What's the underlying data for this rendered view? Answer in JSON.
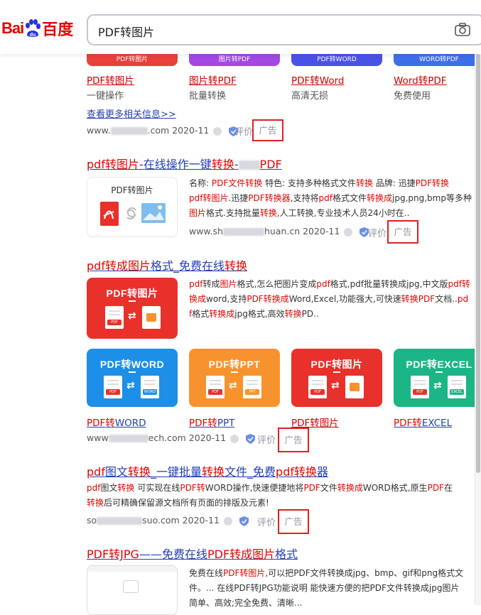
{
  "search": {
    "query": "PDF转图片"
  },
  "logo": {
    "bai": "Bai",
    "du": "du",
    "baidu_cn": "百度"
  },
  "ad1": {
    "bands": [
      "PDF转图片",
      "图片转PDF",
      "PDF转WORD",
      "WORD转PDF"
    ],
    "links": [
      "PDF转图片",
      "图片转PDF",
      "PDF转Word",
      "Word转PDF"
    ],
    "subs": [
      "一键操作",
      "批量转换",
      "高清无损",
      "免费使用"
    ],
    "more": "查看更多相关信息>>",
    "url_prefix": "www.",
    "url_suffix": ".com 2020-11",
    "review": "评价",
    "ad": "广告"
  },
  "result2": {
    "title_parts": [
      "pdf",
      "转图片",
      "-在线操作一键",
      "转换",
      "-",
      "PDF"
    ],
    "thumb_label": "PDF转图片",
    "desc_lines": [
      [
        "名称: ",
        "PDF文件转换",
        "    特色: 支持多种格式文件",
        "转换",
        "    品牌: 迅捷",
        "PDF转换"
      ],
      [
        "pdf转图片",
        ".迅捷",
        "PDF转换器",
        ",支持将",
        "pdf",
        "格式文件",
        "转换成",
        "jpg,png,bmp等多种"
      ],
      [
        "图片",
        "格式.支持批量",
        "转换",
        ",人工转换,专业技术人员24小时在.."
      ]
    ],
    "url_prefix": "www.sh",
    "url_suffix": "huan.cn 2020-11",
    "review": "评价",
    "ad": "广告"
  },
  "result3": {
    "title_parts": [
      "pdf",
      "转成",
      "图片",
      "格式_免费在线",
      "转换"
    ],
    "promo_main": "PDF转图片",
    "desc_lines": [
      [
        "pdf",
        "转成",
        "图片",
        "格式,怎么把图片变成",
        "pdf",
        "格式,pdf批量转换成jpg,中文版",
        "pdf转"
      ],
      [
        "换成",
        "word,支持",
        "PDF转换成",
        "Word,Excel,功能强大,可快速",
        "转换PDF",
        "文档..",
        "pd"
      ],
      [
        "f",
        "格式",
        "转换成",
        "jpg格式,高效",
        "转换",
        "PD.."
      ]
    ],
    "cards": [
      {
        "label": "PDF转WORD",
        "link": "PDF转WORD",
        "color": "#1e8fe6"
      },
      {
        "label": "PDF转PPT",
        "link": "PDF转PPT",
        "color": "#f7932f"
      },
      {
        "label": "PDF转图片",
        "link": "PDF转图片",
        "color": "#e8312b"
      },
      {
        "label": "PDF转EXCEL",
        "link": "PDF转EXCEL",
        "color": "#1cb585"
      }
    ],
    "url_prefix": "www",
    "url_suffix": "ech.com 2020-11",
    "review": "评价",
    "ad": "广告"
  },
  "result4": {
    "title_parts": [
      "pdf",
      "图文",
      "转换",
      "_一键批量",
      "转换",
      "文件_免费",
      "pdf转换",
      "器"
    ],
    "desc_lines": [
      [
        "pdf",
        "图文",
        "转换",
        " 可实现在线",
        "PDF转",
        "WORD操作,快速便捷地将",
        "PDF",
        "文件",
        "转换成",
        "WORD格式,原生",
        "PDF",
        "在"
      ],
      [
        "转换",
        "后可精确保留源文档所有页面的排版及元素!"
      ]
    ],
    "url_prefix": "so",
    "url_suffix": "suo.com 2020-11",
    "review": "评价",
    "ad": "广告"
  },
  "result5": {
    "title_parts": [
      "PDF转JPG",
      "——免费在线",
      "PDF转成图片",
      "格式"
    ],
    "desc_lines": [
      [
        "免费在线",
        "PDF转图片",
        ",可以把PDF文件转换成jpg、bmp、gif和png格式文"
      ],
      [
        "件。... 在线PDF转JPG功能说明 能快速方便的把PDF文件转换成jpg图片"
      ],
      [
        "简单、高效;完全免费、清晰..."
      ]
    ]
  }
}
